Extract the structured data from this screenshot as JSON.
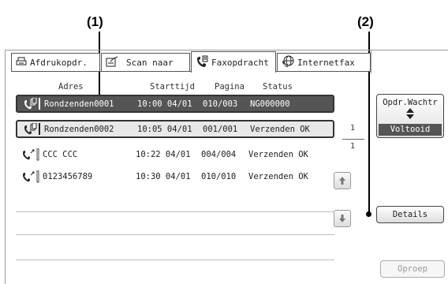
{
  "callouts": {
    "one": "(1)",
    "two": "(2)"
  },
  "tabs": [
    {
      "label": "Afdrukopdr."
    },
    {
      "label": "Scan naar"
    },
    {
      "label": "Faxopdracht"
    },
    {
      "label": "Internetfax"
    }
  ],
  "columns": {
    "address": "Adres",
    "start": "Starttijd",
    "page": "Pagina",
    "status": "Status"
  },
  "rows": [
    {
      "address": "Rondzenden0001",
      "start": "10:00 04/01",
      "page": "010/003",
      "status": "NG000000"
    },
    {
      "address": "Rondzenden0002",
      "start": "10:05 04/01",
      "page": "001/001",
      "status": "Verzenden OK"
    },
    {
      "address": "CCC CCC",
      "start": "10:22 04/01",
      "page": "004/004",
      "status": "Verzenden OK"
    },
    {
      "address": "0123456789",
      "start": "10:30 04/01",
      "page": "010/010",
      "status": "Verzenden OK"
    }
  ],
  "pager": {
    "current": "1",
    "total": "1"
  },
  "right_panel": {
    "queue_label": "Opdr.Wachtr",
    "done_label": "Voltooid",
    "details_label": "Details",
    "recall_label": "Oproep"
  }
}
